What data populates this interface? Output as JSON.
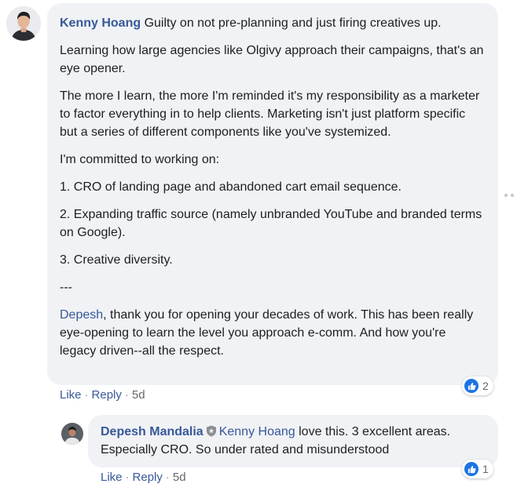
{
  "comment": {
    "author": "Kenny Hoang",
    "first_line": " Guilty on not pre-planning and just firing creatives up.",
    "paragraphs": [
      "Learning how large agencies like Olgivy approach their campaigns, that's an eye opener.",
      "The more I learn, the more I'm reminded it's my responsibility as a marketer to factor everything in to help clients. Marketing isn't just platform specific but a series of different components like you've systemized.",
      "I'm committed to working on:",
      "1. CRO of landing page and abandoned cart email sequence.",
      "2. Expanding traffic source (namely unbranded YouTube and branded terms on Google).",
      "3. Creative diversity.",
      "---"
    ],
    "final_mention": "Depesh",
    "final_text": ", thank you for opening your decades of work. This has been really eye-opening to learn the level you approach e-comm. And how you're legacy driven--all the respect.",
    "like_label": "Like",
    "reply_label": "Reply",
    "separator": "·",
    "time": "5d",
    "reaction_count": "2"
  },
  "reply": {
    "author": "Depesh Mandalia",
    "mention": "Kenny Hoang",
    "text": " love this. 3 excellent areas. Especially CRO. So under rated and misunderstood",
    "like_label": "Like",
    "reply_label": "Reply",
    "separator": "·",
    "time": "5d",
    "reaction_count": "1"
  },
  "icons": {
    "reaction": "like-thumb-icon",
    "badge": "shield-badge-icon",
    "more": "more-options-icon"
  },
  "colors": {
    "link": "#385898",
    "bubble": "#f0f2f5",
    "meta": "#65676b",
    "like_blue": "#1b74e4"
  }
}
